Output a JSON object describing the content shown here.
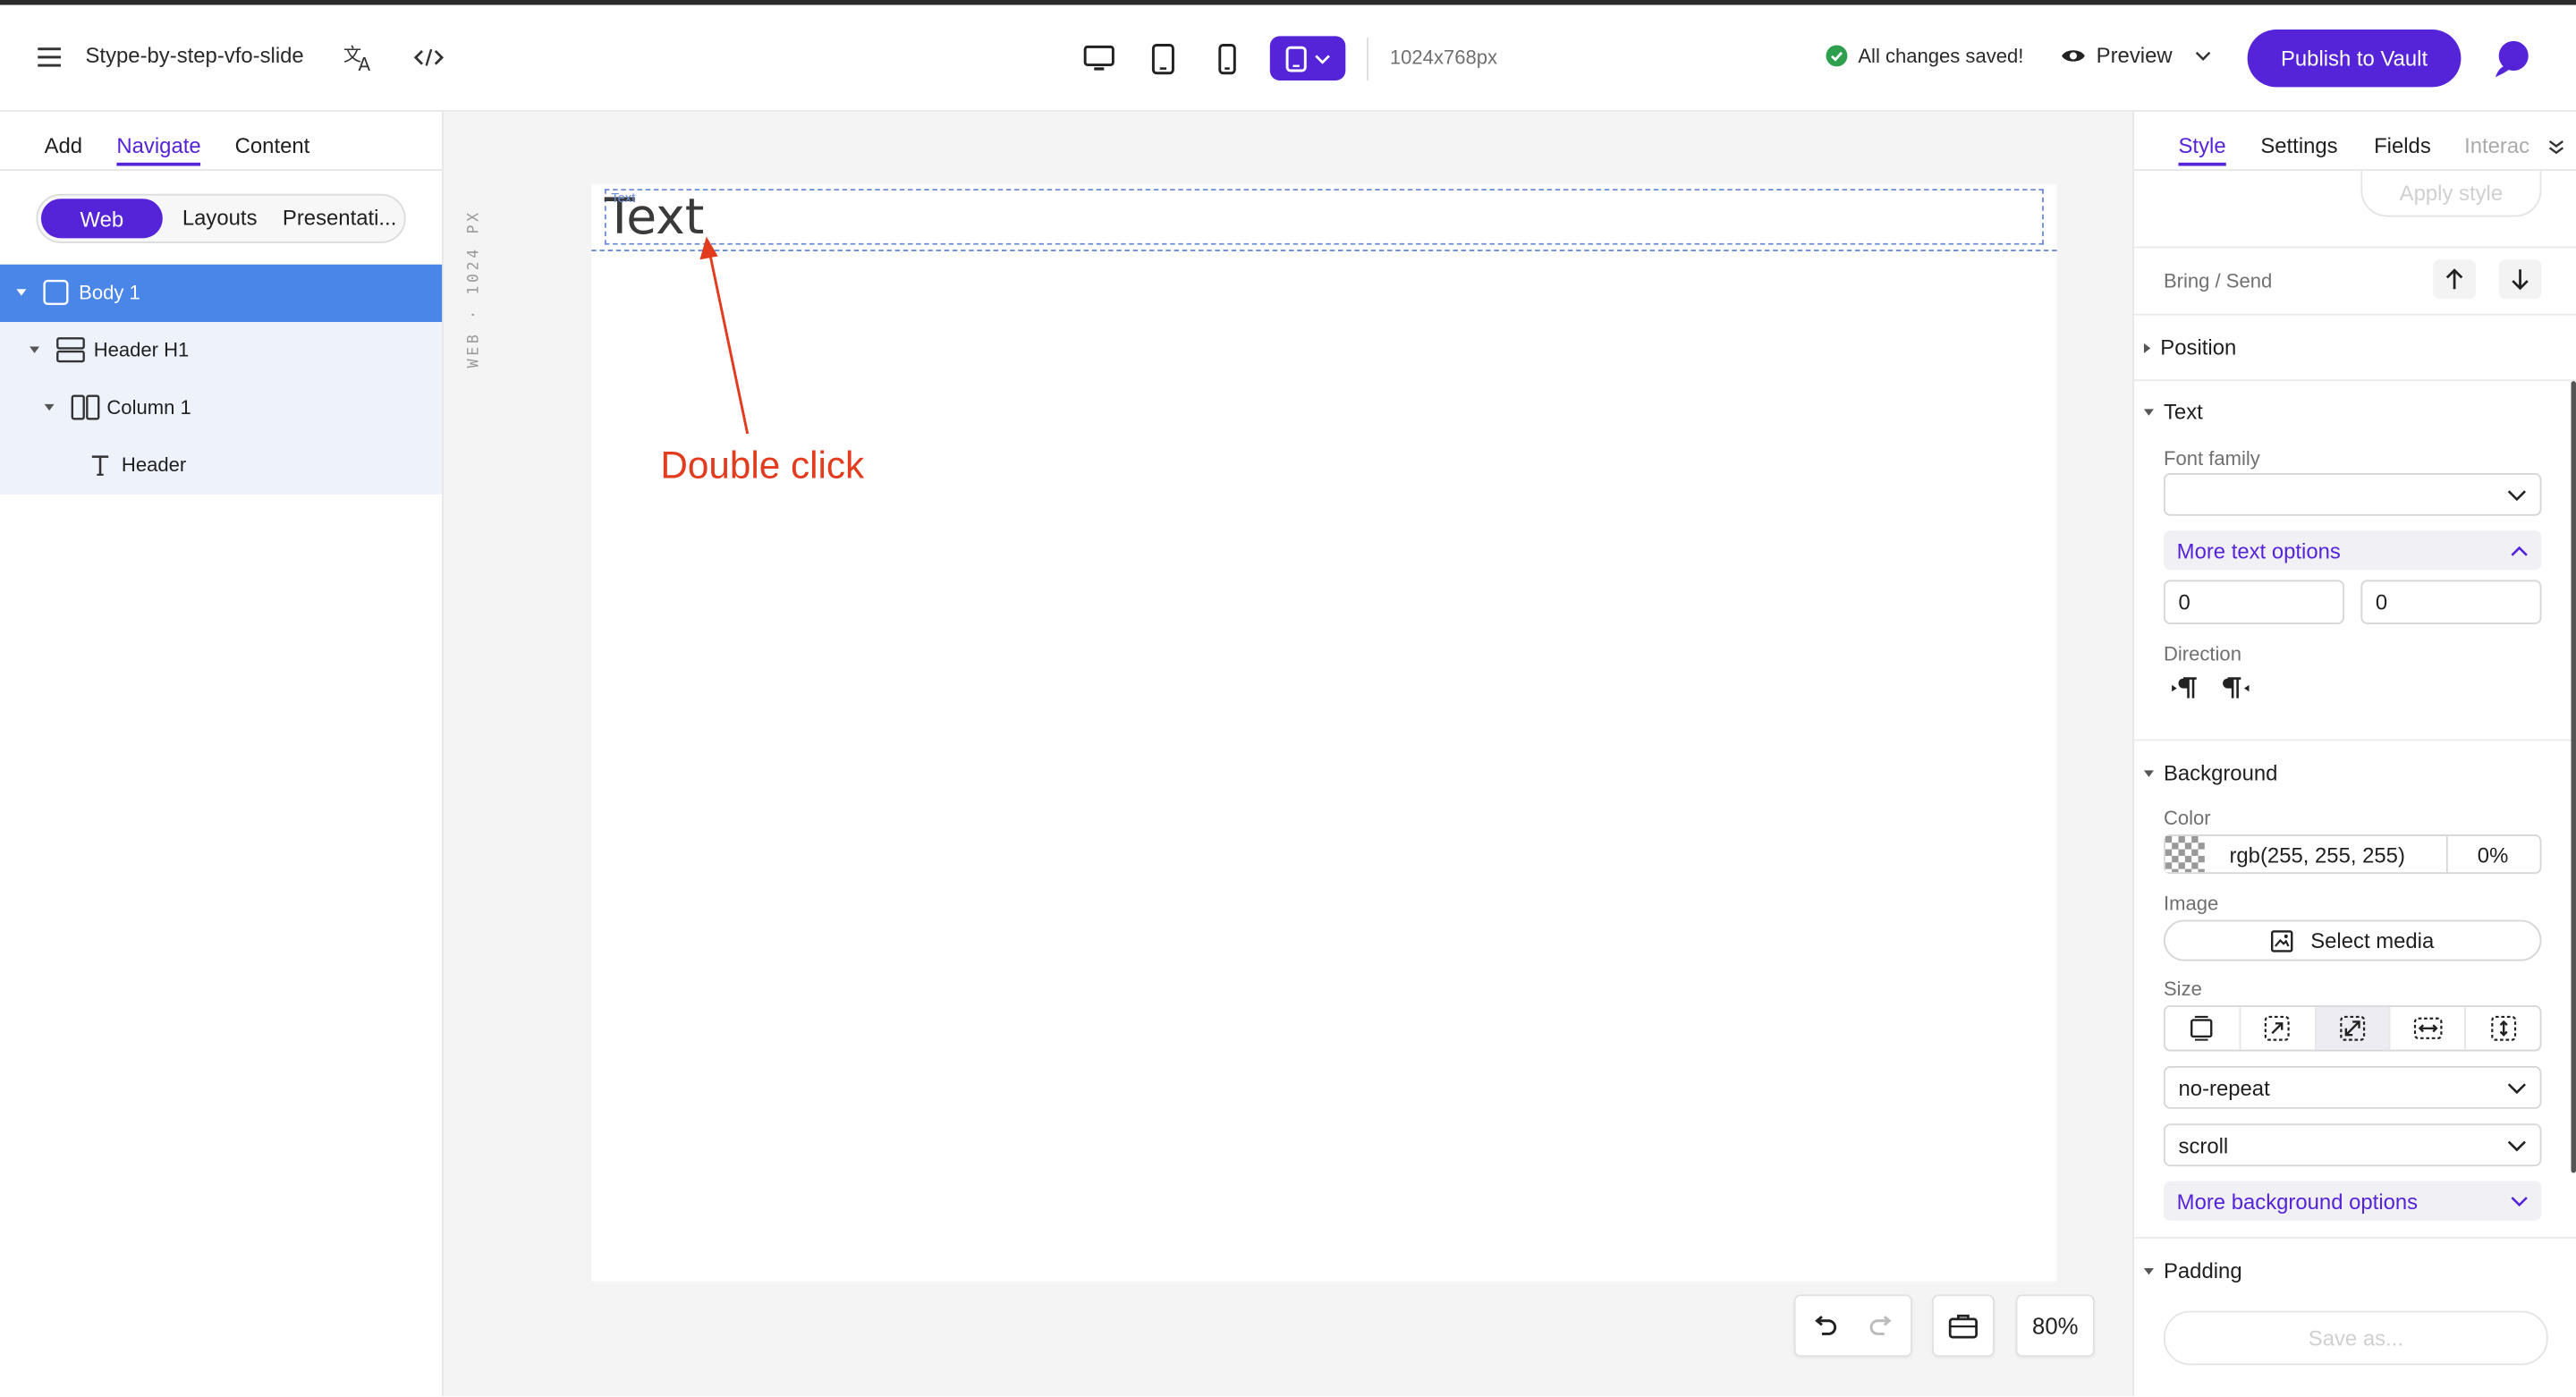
{
  "topbar": {
    "doc_title": "Stype-by-step-vfo-slide",
    "dimensions": "1024x768px",
    "saved_status": "All changes saved!",
    "preview_label": "Preview",
    "publish_label": "Publish to Vault"
  },
  "left_panel": {
    "tabs": [
      "Add",
      "Navigate",
      "Content"
    ],
    "active_tab": "Navigate",
    "segments": [
      "Web",
      "Layouts",
      "Presentati..."
    ],
    "tree": [
      {
        "label": "Body 1",
        "icon": "square-icon",
        "selected": true
      },
      {
        "label": "Header H1",
        "icon": "section-icon",
        "selected": false
      },
      {
        "label": "Column 1",
        "icon": "columns-icon",
        "selected": false
      },
      {
        "label": "Header",
        "icon": "text-t-icon",
        "selected": false
      }
    ]
  },
  "canvas": {
    "ruler_label": "WEB · 1024 PX",
    "element_tag": "Text",
    "heading_text": "Text",
    "annotation": "Double click",
    "zoom": "80%"
  },
  "right_panel": {
    "tabs": [
      "Style",
      "Settings",
      "Fields",
      "Interac"
    ],
    "active_tab": "Style",
    "apply_style": "Apply style",
    "bring_send": "Bring / Send",
    "section_position": "Position",
    "section_text": "Text",
    "font_family_label": "Font family",
    "more_text_options": "More text options",
    "text_val_1": "0",
    "text_val_2": "0",
    "direction_label": "Direction",
    "section_background": "Background",
    "color_label": "Color",
    "color_value": "rgb(255, 255, 255)",
    "opacity_value": "0%",
    "image_label": "Image",
    "select_media": "Select media",
    "size_label": "Size",
    "repeat_value": "no-repeat",
    "attachment_value": "scroll",
    "more_background_options": "More background options",
    "section_padding": "Padding",
    "save_as": "Save as..."
  },
  "colors": {
    "accent": "#5523d8",
    "selection": "#4a86e8",
    "annotation": "#e23b1e",
    "saved_ok": "#2e9e4f"
  }
}
